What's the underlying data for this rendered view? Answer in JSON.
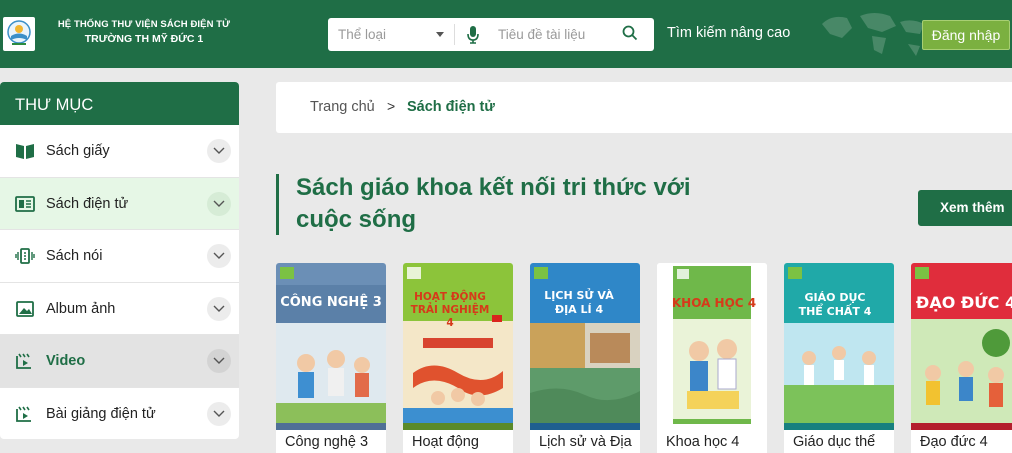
{
  "header": {
    "brand_line1": "HỆ THỐNG THƯ VIỆN SÁCH ĐIỆN TỬ",
    "brand_line2": "TRƯỜNG TH MỸ ĐỨC 1",
    "category_select": "Thể loại",
    "search_placeholder": "Tiêu đề tài liệu",
    "advanced_search": "Tìm kiếm nâng cao",
    "login_label": "Đăng nhập",
    "brand_color": "#1f6e46",
    "login_color": "#7bb040"
  },
  "sidebar": {
    "title": "THƯ MỤC",
    "items": [
      {
        "label": "Sách giấy",
        "icon": "open-book-icon"
      },
      {
        "label": "Sách điện tử",
        "icon": "ebook-icon"
      },
      {
        "label": "Sách nói",
        "icon": "audio-book-icon"
      },
      {
        "label": "Album ảnh",
        "icon": "image-icon"
      },
      {
        "label": "Video",
        "icon": "video-icon"
      },
      {
        "label": "Bài giảng điện tử",
        "icon": "lecture-icon"
      }
    ]
  },
  "breadcrumb": {
    "home": "Trang chủ",
    "separator": ">",
    "current": "Sách điện tử"
  },
  "section": {
    "title": "Sách giáo khoa kết nối tri thức với cuộc sống",
    "more_label": "Xem thêm"
  },
  "books": [
    {
      "caption": "Công nghệ 3",
      "cover_title": "CÔNG NGHỆ 3",
      "cover_color": "#6b8fb6"
    },
    {
      "caption": "Hoạt động",
      "cover_title": "HOẠT ĐỘNG TRẢI NGHIỆM 4",
      "cover_color": "#8cc43a"
    },
    {
      "caption": "Lịch sử và Địa",
      "cover_title": "LỊCH SỬ VÀ ĐỊA LÍ 4",
      "cover_color": "#2f87c8"
    },
    {
      "caption": "Khoa học 4",
      "cover_title": "KHOA HỌC 4",
      "cover_color": "#6fb84a"
    },
    {
      "caption": "Giáo dục thể",
      "cover_title": "GIÁO DỤC THỂ CHẤT 4",
      "cover_color": "#20a9a8"
    },
    {
      "caption": "Đạo đức 4",
      "cover_title": "ĐẠO ĐỨC 4",
      "cover_color": "#e02d3c"
    }
  ]
}
